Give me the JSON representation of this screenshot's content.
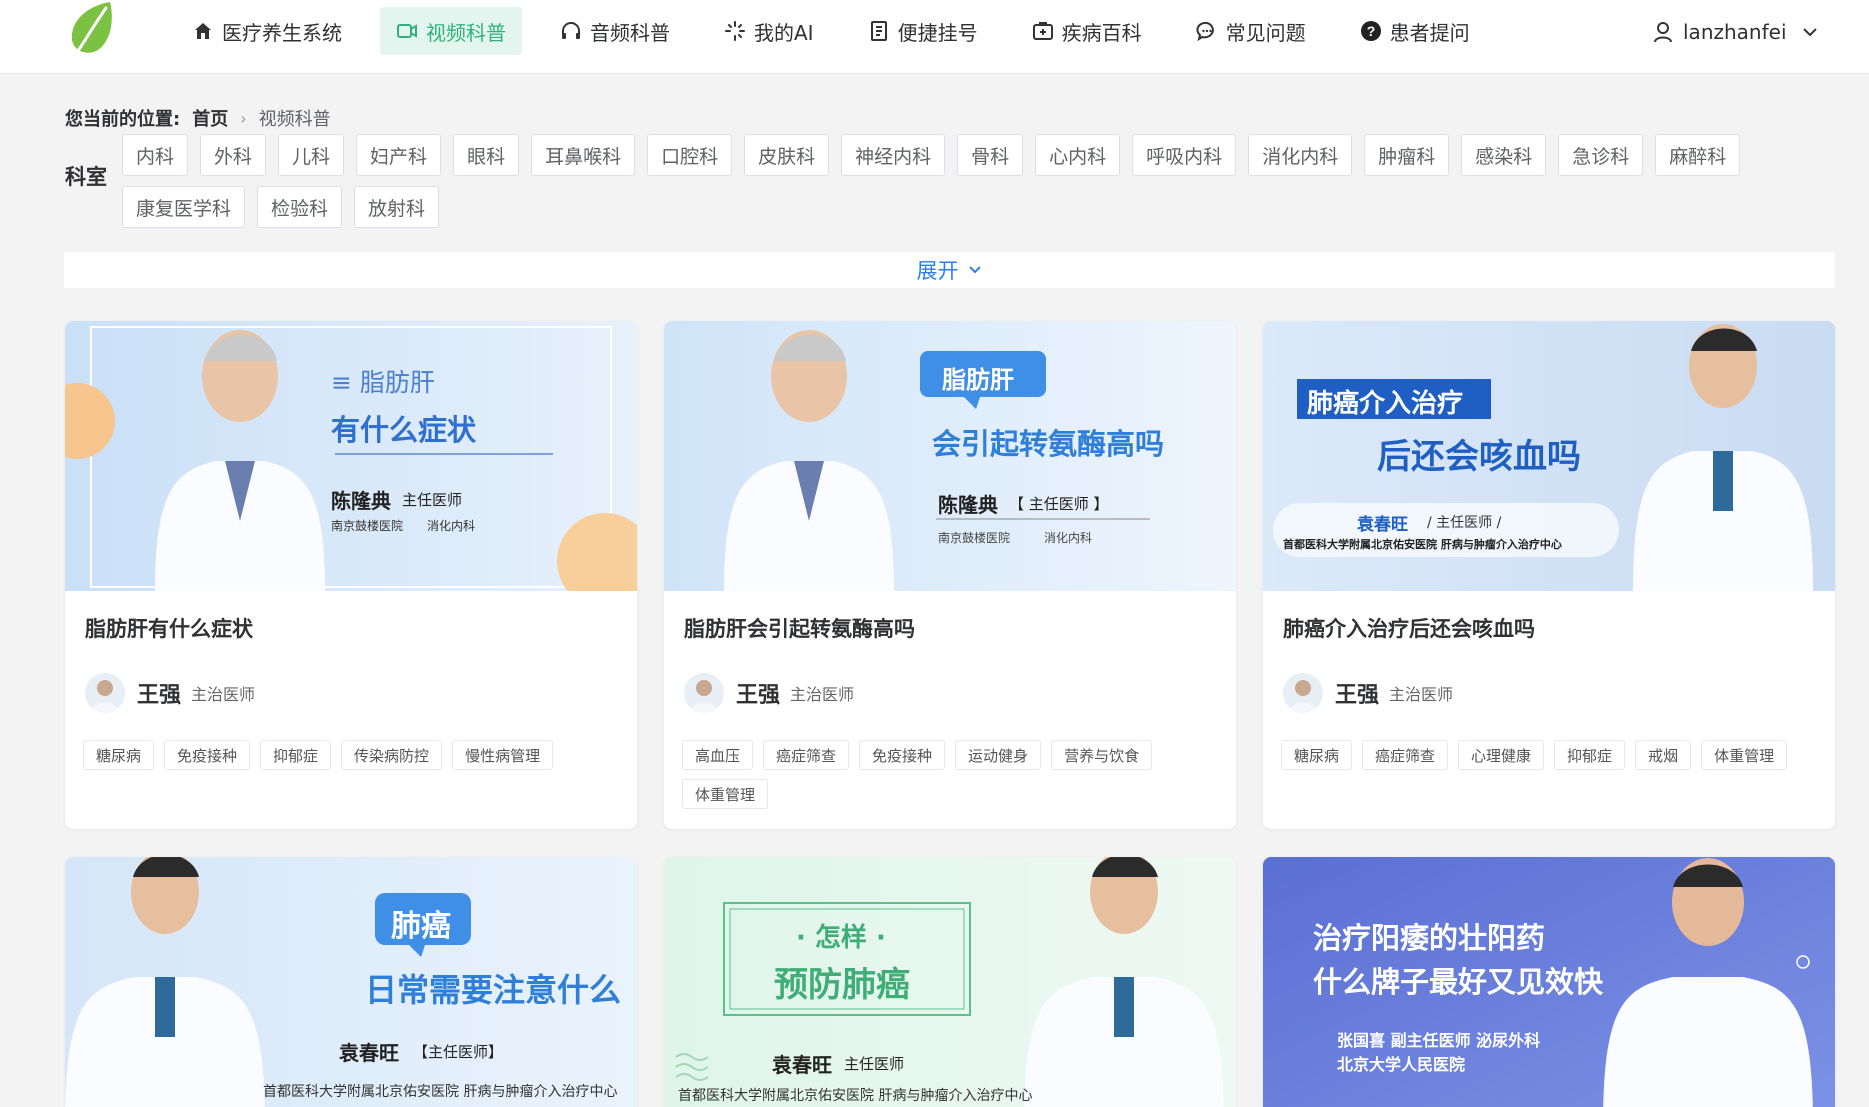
{
  "nav": {
    "items": [
      {
        "label": "医疗养生系统",
        "icon": "home-icon"
      },
      {
        "label": "视频科普",
        "icon": "video-icon",
        "active": true
      },
      {
        "label": "音频科普",
        "icon": "headphones-icon"
      },
      {
        "label": "我的AI",
        "icon": "ai-sparkle-icon"
      },
      {
        "label": "便捷挂号",
        "icon": "register-icon"
      },
      {
        "label": "疾病百科",
        "icon": "medical-box-icon"
      },
      {
        "label": "常见问题",
        "icon": "chat-icon"
      },
      {
        "label": "患者提问",
        "icon": "question-circle-icon"
      }
    ],
    "user": "lanzhanfei"
  },
  "breadcrumb": {
    "label": "您当前的位置:",
    "home": "首页",
    "current": "视频科普"
  },
  "filter": {
    "dept_label": "科室",
    "depts_row1": [
      "内科",
      "外科",
      "儿科",
      "妇产科",
      "眼科",
      "耳鼻喉科",
      "口腔科",
      "皮肤科",
      "神经内科",
      "骨科",
      "心内科",
      "呼吸内科",
      "消化内科",
      "肿瘤科",
      "感染科",
      "急诊科",
      "麻醉科"
    ],
    "depts_row2": [
      "康复医学科",
      "检验科",
      "放射科"
    ],
    "expand": "展开"
  },
  "cards": [
    {
      "title": "脂肪肝有什么症状",
      "author": "王强",
      "role": "主治医师",
      "tags": [
        "糖尿病",
        "免疫接种",
        "抑郁症",
        "传染病防控",
        "慢性病管理"
      ],
      "poster": {
        "line1": "≡ 脂肪肝",
        "line2": "有什么症状",
        "doctor": "陈隆典",
        "doctor_title": "主任医师",
        "hospital": "南京鼓楼医院",
        "dept": "消化内科"
      }
    },
    {
      "title": "脂肪肝会引起转氨酶高吗",
      "author": "王强",
      "role": "主治医师",
      "tags": [
        "高血压",
        "癌症筛查",
        "免疫接种",
        "运动健身",
        "营养与饮食",
        "体重管理"
      ],
      "poster": {
        "badge": "脂肪肝",
        "line2": "会引起转氨酶高吗",
        "doctor": "陈隆典",
        "doctor_title": "【 主任医师 】",
        "hospital": "南京鼓楼医院",
        "dept": "消化内科"
      }
    },
    {
      "title": "肺癌介入治疗后还会咳血吗",
      "author": "王强",
      "role": "主治医师",
      "tags": [
        "糖尿病",
        "癌症筛查",
        "心理健康",
        "抑郁症",
        "戒烟",
        "体重管理"
      ],
      "poster": {
        "badge": "肺癌介入治疗",
        "line2": "后还会咳血吗",
        "doctor": "袁春旺",
        "doctor_title": "/ 主任医师 /",
        "hospital": "首都医科大学附属北京佑安医院  肝病与肿瘤介入治疗中心"
      }
    },
    {
      "poster": {
        "badge": "肺癌",
        "line2": "日常需要注意什么",
        "doctor": "袁春旺",
        "doctor_title": "【主任医师】",
        "hospital": "首都医科大学附属北京佑安医院 肝病与肿瘤介入治疗中心"
      }
    },
    {
      "poster": {
        "line1": "· 怎样 ·",
        "line2": "预防肺癌",
        "doctor": "袁春旺",
        "doctor_title": "主任医师",
        "hospital": "首都医科大学附属北京佑安医院 肝病与肿瘤介入治疗中心"
      }
    },
    {
      "poster": {
        "line1": "治疗阳痿的壮阳药",
        "line2": "什么牌子最好又见效快",
        "doctor": "张国喜  副主任医师  泌尿外科",
        "hospital": "北京大学人民医院"
      }
    }
  ],
  "colors": {
    "accent": "#2fb37a",
    "link": "#2f7ee8",
    "active_bg": "#e3f5ee"
  }
}
